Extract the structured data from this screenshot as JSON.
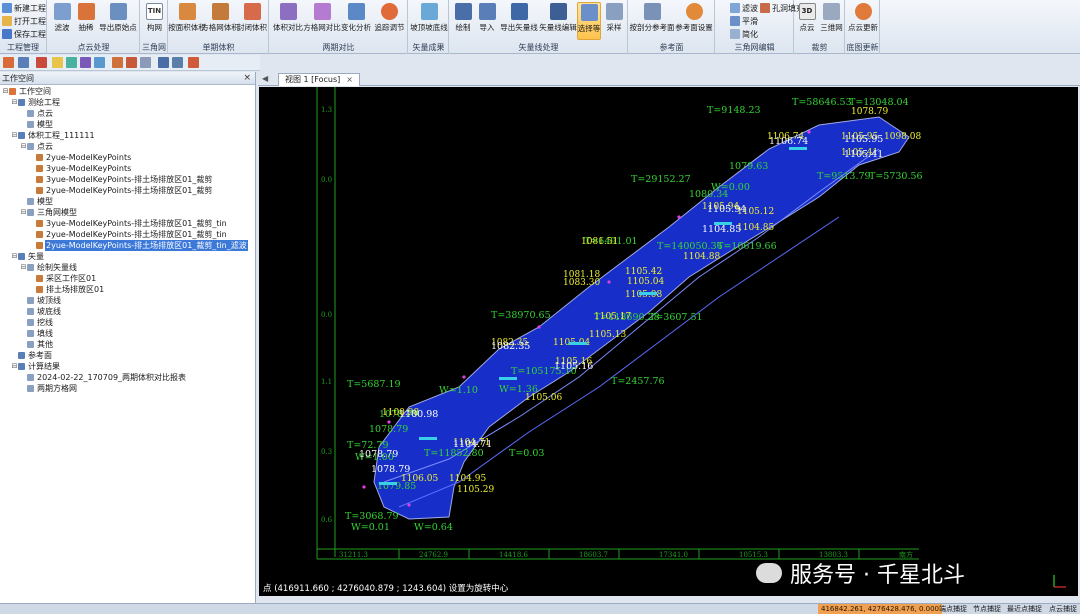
{
  "ribbon": {
    "project_buttons": [
      "新建工程",
      "打开工程",
      "保存工程"
    ],
    "groups": [
      {
        "label": "工程管理"
      },
      {
        "label": "点云处理"
      },
      {
        "label": "三角网"
      },
      {
        "label": "单期体积"
      },
      {
        "label": "两期对比"
      },
      {
        "label": "矢量成果"
      },
      {
        "label": "矢量线处理"
      },
      {
        "label": "参考面"
      },
      {
        "label": "三角网编辑"
      },
      {
        "label": "裁剪"
      },
      {
        "label": "底图更新"
      }
    ],
    "buttons": [
      "滤波",
      "抽稀",
      "导出原始点",
      "构网",
      "按面积体积",
      "方格网体积",
      "封闭体积",
      "体积对比",
      "方格网对比",
      "变化分析",
      "追踪调节",
      "坡顶坡底线",
      "绘制",
      "导入",
      "导出矢量线",
      "矢量线编辑",
      "选择等",
      "采样",
      "按剖分参考面",
      "参考面设置",
      "点云",
      "三维网",
      "点云更新"
    ],
    "small_buttons": [
      "滤波",
      "孔洞填充",
      "平滑",
      "简化"
    ],
    "active_button": "选择等"
  },
  "workspace": {
    "title": "工作空间",
    "close": "×",
    "tree": [
      {
        "label": "工作空间",
        "level": 0,
        "expander": "⊟"
      },
      {
        "label": "测绘工程",
        "level": 1,
        "expander": "⊟"
      },
      {
        "label": "点云",
        "level": 2,
        "expander": ""
      },
      {
        "label": "模型",
        "level": 2,
        "expander": ""
      },
      {
        "label": "体积工程_111111",
        "level": 1,
        "expander": "⊟"
      },
      {
        "label": "点云",
        "level": 2,
        "expander": "⊟"
      },
      {
        "label": "2yue-ModelKeyPoints",
        "level": 3,
        "expander": ""
      },
      {
        "label": "3yue-ModelKeyPoints",
        "level": 3,
        "expander": ""
      },
      {
        "label": "3yue-ModelKeyPoints-排土场排放区01_裁剪",
        "level": 3,
        "expander": ""
      },
      {
        "label": "2yue-ModelKeyPoints-排土场排放区01_裁剪",
        "level": 3,
        "expander": ""
      },
      {
        "label": "模型",
        "level": 2,
        "expander": ""
      },
      {
        "label": "三角网模型",
        "level": 2,
        "expander": "⊟"
      },
      {
        "label": "3yue-ModelKeyPoints-排土场排放区01_裁剪_tin",
        "level": 3,
        "expander": ""
      },
      {
        "label": "2yue-ModelKeyPoints-排土场排放区01_裁剪_tin",
        "level": 3,
        "expander": ""
      },
      {
        "label": "2yue-ModelKeyPoints-排土场排放区01_裁剪_tin_滤波",
        "level": 3,
        "expander": "",
        "selected": true
      },
      {
        "label": "矢量",
        "level": 1,
        "expander": "⊟"
      },
      {
        "label": "绘制矢量线",
        "level": 2,
        "expander": "⊟"
      },
      {
        "label": "采区工作区01",
        "level": 3,
        "expander": ""
      },
      {
        "label": "排土场排放区01",
        "level": 3,
        "expander": ""
      },
      {
        "label": "坡顶线",
        "level": 2,
        "expander": ""
      },
      {
        "label": "坡底线",
        "level": 2,
        "expander": ""
      },
      {
        "label": "挖线",
        "level": 2,
        "expander": ""
      },
      {
        "label": "填线",
        "level": 2,
        "expander": ""
      },
      {
        "label": "其他",
        "level": 2,
        "expander": ""
      },
      {
        "label": "参考面",
        "level": 1,
        "expander": ""
      },
      {
        "label": "计算结果",
        "level": 1,
        "expander": "⊟"
      },
      {
        "label": "2024-02-22_170709_两期体积对比报表",
        "level": 2,
        "expander": ""
      },
      {
        "label": "两期方格网",
        "level": 2,
        "expander": ""
      }
    ]
  },
  "view": {
    "tab_label": "视图 1 [Focus]",
    "tab_close": "×",
    "coord_line": "点 (416911.660 ; 4276040.879 ; 1243.604) 设置为旋转中心",
    "axis_left": [
      "1.3",
      "0.0",
      "0.0",
      "1.1",
      "0.3",
      "0.6"
    ],
    "axis_bottom": [
      "31211.3",
      "24762.9",
      "14418.6",
      "18603.7",
      "17341.0",
      "10515.3",
      "13803.3"
    ],
    "axis_bottom_right": "南方",
    "labels_yellow": [
      "1078.79",
      "1105.95",
      "1098.08",
      "1106.74",
      "1105.41",
      "1105.94",
      "1105.12",
      "1104.85",
      "1104.88",
      "1105.42",
      "1105.04",
      "1105.08",
      "1081.18",
      "1083.30",
      "1081.51",
      "1105.17",
      "1105.13",
      "1105.16",
      "1082.35",
      "1105.04",
      "1105.06",
      "1100.98",
      "1104.71",
      "1106.05",
      "1104.95",
      "1105.29"
    ],
    "labels_green": [
      "T=9148.23",
      "T=58646.53",
      "T=13048.04",
      "T=29152.27",
      "T=140050.36",
      "T=10619.66",
      "T=6491.01",
      "T=38970.65",
      "T=118690.28",
      "T=3607.51",
      "T=105175.10",
      "T=2457.76",
      "T=5687.19",
      "T=11852.80",
      "T=0.03",
      "T=72.79",
      "T=3068.79",
      "W=1.00",
      "W=0.00",
      "W=0.01",
      "W=0.64",
      "W=1.36",
      "W=1.10",
      "T=9513.79",
      "T=5730.56",
      "1079.63",
      "1080.34",
      "1078.79",
      "1078.79",
      "1079.85"
    ],
    "labels_white": [
      "1105.95",
      "1106.74",
      "1105.94",
      "1105.41",
      "1104.85",
      "1082.35",
      "1105.16",
      "1100.98",
      "1078.79",
      "1104.71",
      "1078.79"
    ]
  },
  "watermark": "服务号 · 千星北斗",
  "status": {
    "coords": "416842.261, 4276428.476, 0.000",
    "items": [
      "端点捕捉",
      "节点捕捉",
      "最近点捕捉",
      "点云捕捉"
    ]
  },
  "colors": {
    "surface": "#1a34d9",
    "surface_edge": "#aeb8ff",
    "label_green": "#35d435",
    "label_yellow": "#f0f032",
    "label_cyan": "#37d0e6",
    "label_magenta": "#e040e0",
    "highlight_tab": "#3b78d8",
    "status_coord": "#f0a050"
  },
  "icons": [
    "new-project-icon",
    "open-project-icon",
    "save-project-icon",
    "filter-icon",
    "close-icon"
  ]
}
